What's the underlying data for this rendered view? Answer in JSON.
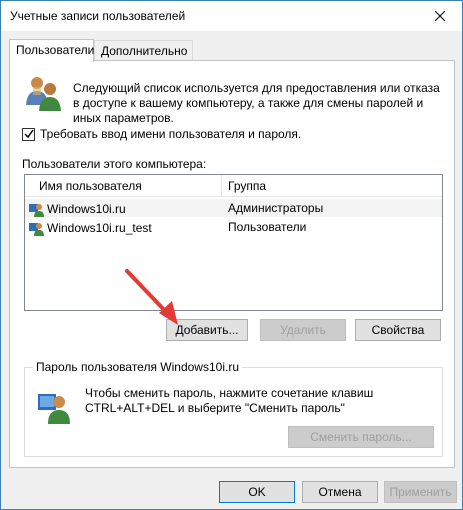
{
  "window": {
    "title": "Учетные записи пользователей"
  },
  "tabs": [
    {
      "label": "Пользователи",
      "active": true
    },
    {
      "label": "Дополнительно",
      "active": false
    }
  ],
  "users_tab": {
    "intro": "Следующий список используется для предоставления или отказа в доступе к вашему компьютеру, а также для смены паролей и иных параметров.",
    "require_login_label": "Требовать ввод имени пользователя и пароля.",
    "require_login_checked": true,
    "list_label": "Пользователи этого компьютера:",
    "columns": [
      "Имя пользователя",
      "Группа"
    ],
    "rows": [
      {
        "name": "Windows10i.ru",
        "group": "Администраторы",
        "selected": true
      },
      {
        "name": "Windows10i.ru_test",
        "group": "Пользователи",
        "selected": false
      }
    ],
    "buttons": {
      "add": "Добавить...",
      "remove": "Удалить",
      "properties": "Свойства"
    },
    "password_group": {
      "title": "Пароль пользователя Windows10i.ru",
      "text": "Чтобы сменить пароль, нажмите сочетание клавиш CTRL+ALT+DEL и выберите \"Сменить пароль\"",
      "change_button": "Сменить пароль..."
    }
  },
  "dialog_buttons": {
    "ok": "OK",
    "cancel": "Отмена",
    "apply": "Применить"
  },
  "colors": {
    "window_border": "#3c7fb1",
    "annotation_arrow": "#e53935",
    "default_button_border": "#0078d7"
  },
  "icons": {
    "users": "users-icon",
    "user": "user-icon",
    "password": "password-user-icon",
    "close": "close-icon"
  }
}
